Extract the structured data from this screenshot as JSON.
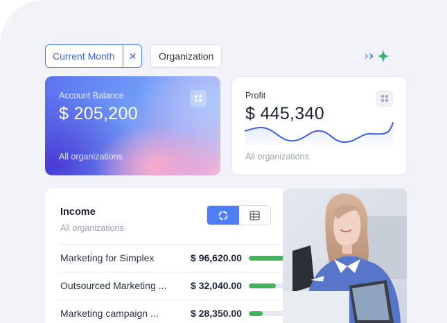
{
  "filters": {
    "active_chip": "Current Month",
    "clear_symbol": "✕",
    "secondary_chip": "Organization"
  },
  "account_balance": {
    "title": "Account Balance",
    "value": "$ 205,200",
    "footer": "All organizations"
  },
  "profit": {
    "title": "Profit",
    "value": "$ 445,340",
    "footer": "All organizations"
  },
  "income": {
    "title": "Income",
    "subtitle": "All organizations",
    "view_options": [
      "chart-view",
      "table-view"
    ],
    "selected_view": "chart-view",
    "rows": [
      {
        "name": "Marketing for Simplex",
        "amount": "$ 96,620.00",
        "share": 0.78
      },
      {
        "name": "Outsourced Marketing ...",
        "amount": "$ 32,040.00",
        "share": 0.55
      },
      {
        "name": "Marketing campaign ...",
        "amount": "$ 28,350.00",
        "share": 0.28
      }
    ]
  },
  "colors": {
    "accent": "#4f7cf7",
    "bar": "#43b35a",
    "sparkline": "#3c5ce6",
    "sparkle_green": "#2fb46a"
  },
  "icons": {
    "sparkle": "sparkle-icon",
    "card_menu": "grid-icon",
    "chart_view": "donut-chart-icon",
    "table_view": "table-icon"
  }
}
